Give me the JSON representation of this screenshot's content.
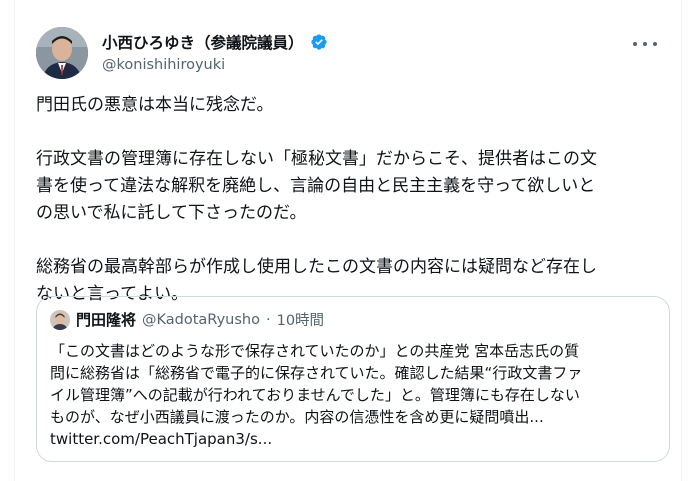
{
  "author": {
    "display_name": "小西ひろゆき（参議院議員）",
    "handle": "@konishihiroyuki",
    "verified": true,
    "avatar": "profile-photo"
  },
  "menu_icon": "more-horizontal-icon",
  "tweet": {
    "paragraphs": [
      "門田氏の悪意は本当に残念だ。",
      "行政文書の管理簿に存在しない「極秘文書」だからこそ、提供者はこの文\n書を使って違法な解釈を廃絶し、言論の自由と民主主義を守って欲しいと\nの思いで私に託して下さったのだ。",
      "総務省の最高幹部らが作成し使用したこの文書の内容には疑問など存在し\nないと言ってよい。"
    ]
  },
  "quoted_tweet": {
    "display_name": "門田隆将",
    "handle": "@KadotaRyusho",
    "separator": "·",
    "time": "10時間",
    "lines": [
      "「この文書はどのような形で保存されていたのか」との共産党 宮本岳志氏の質",
      "問に総務省は「総務省で電子的に保存されていた。確認した結果“行政文書ファ",
      "イル管理簿”への記載が行われておりませんでした」と。管理簿にも存在しない",
      "ものが、なぜ小西議員に渡ったのか。内容の信憑性を含め更に疑問噴出..."
    ],
    "link": "twitter.com/PeachTjapan3/s..."
  },
  "colors": {
    "text_primary": "#0f1419",
    "text_secondary": "#536471",
    "verified_blue": "#1d9bf0",
    "border": "#cfd9de"
  }
}
